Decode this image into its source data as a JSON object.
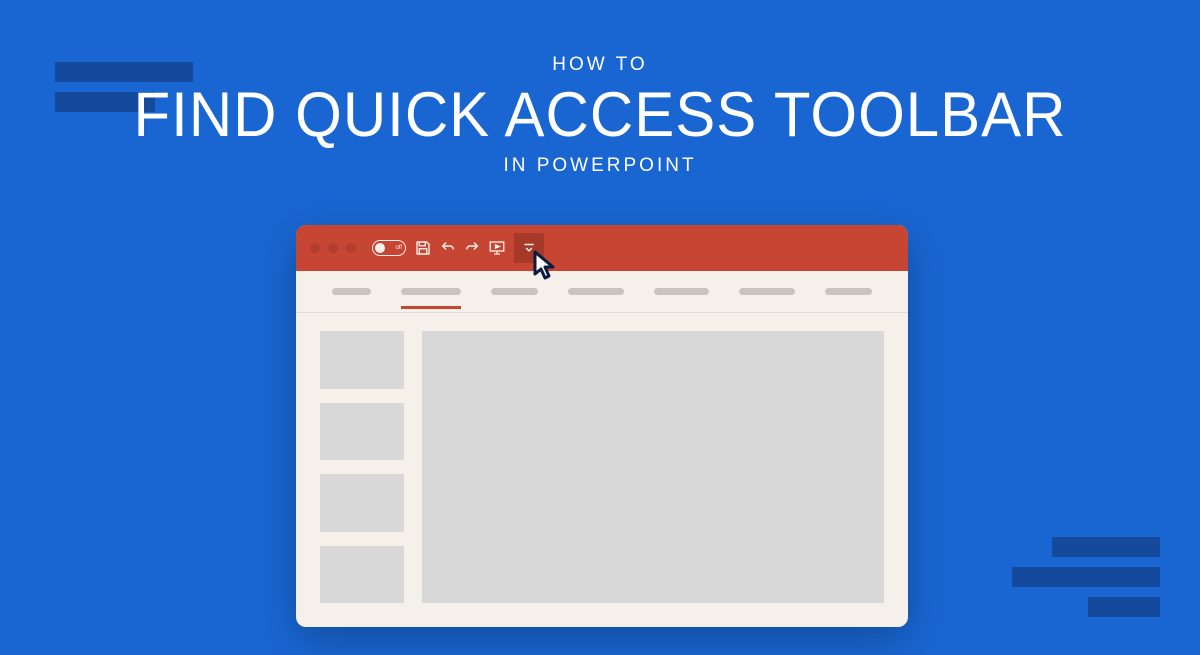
{
  "headline": {
    "pre": "HOW TO",
    "main": "FIND QUICK ACCESS TOOLBAR",
    "post": "IN POWERPOINT"
  },
  "autosave": {
    "label": "off"
  },
  "colors": {
    "background": "#1966d2",
    "accent": "#c74533",
    "panel": "#f5f0ea"
  }
}
